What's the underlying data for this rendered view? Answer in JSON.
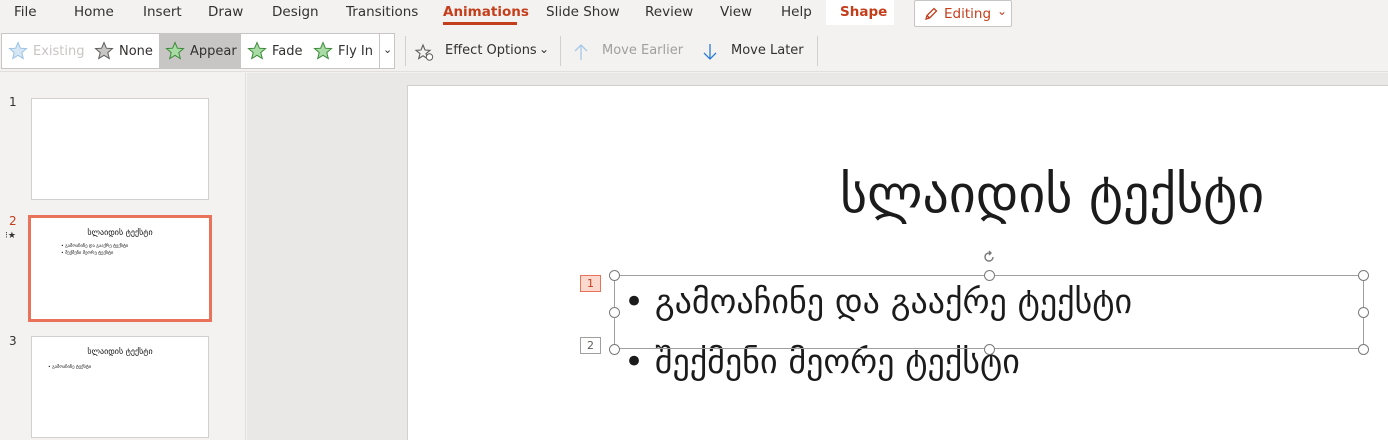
{
  "menu": {
    "items": [
      "File",
      "Home",
      "Insert",
      "Draw",
      "Design",
      "Transitions",
      "Animations",
      "Slide Show",
      "Review",
      "View",
      "Help"
    ],
    "contextual_tab": "Shape",
    "editing_label": "Editing"
  },
  "ribbon": {
    "gallery": {
      "existing": "Existing",
      "none": "None",
      "appear": "Appear",
      "fade": "Fade",
      "fly_in": "Fly In"
    },
    "effect_options": "Effect Options",
    "move_earlier": "Move Earlier",
    "move_later": "Move Later"
  },
  "thumbnails": [
    {
      "number": "1"
    },
    {
      "number": "2",
      "title": "სლაიდის ტექსტი",
      "bullets": [
        "• გამოაჩინე და გააქრე ტექსტი",
        "• შექმენი მეორე ტექსტი"
      ]
    },
    {
      "number": "3",
      "title": "სლაიდის ტექსტი",
      "bullets": [
        "• გამოაჩინე ტექსტი"
      ]
    }
  ],
  "slide": {
    "title": "სლაიდის ტექსტი",
    "bullets": [
      "• გამოაჩინე და გააქრე ტექსტი",
      "• შექმენი მეორე ტექსტი"
    ],
    "animation_tags": [
      "1",
      "2"
    ]
  },
  "colors": {
    "accent": "#c43e1c",
    "thumb_selected_border": "#e8735a"
  }
}
